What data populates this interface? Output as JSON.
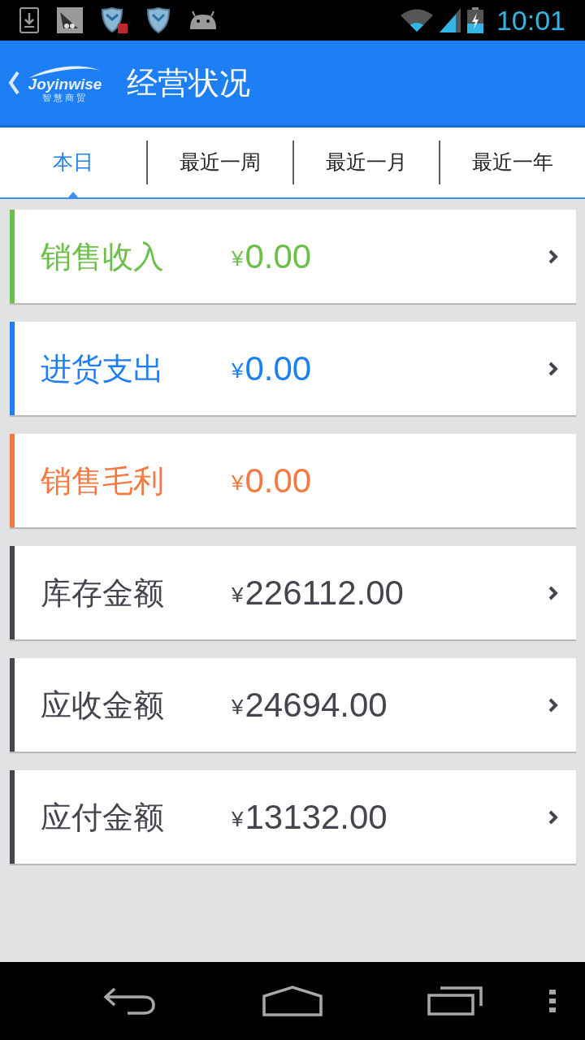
{
  "status_bar": {
    "time": "10:01"
  },
  "app_bar": {
    "logo": {
      "name": "Joyinwise",
      "subtitle": "智慧商贸"
    },
    "title": "经营状况"
  },
  "tabs": [
    {
      "label": "本日",
      "selected": true
    },
    {
      "label": "最近一周",
      "selected": false
    },
    {
      "label": "最近一月",
      "selected": false
    },
    {
      "label": "最近一年",
      "selected": false
    }
  ],
  "cards": [
    {
      "label": "销售收入",
      "currency": "¥",
      "amount": "0.00",
      "color": "#6cc04a",
      "has_arrow": true
    },
    {
      "label": "进货支出",
      "currency": "¥",
      "amount": "0.00",
      "color": "#1e7ff5",
      "has_arrow": true
    },
    {
      "label": "销售毛利",
      "currency": "¥",
      "amount": "0.00",
      "color": "#f47a42",
      "has_arrow": false
    },
    {
      "label": "库存金额",
      "currency": "¥",
      "amount": "226112.00",
      "color": "#45444f",
      "has_arrow": true
    },
    {
      "label": "应收金额",
      "currency": "¥",
      "amount": "24694.00",
      "color": "#45444f",
      "has_arrow": true
    },
    {
      "label": "应付金额",
      "currency": "¥",
      "amount": "13132.00",
      "color": "#45444f",
      "has_arrow": true
    }
  ]
}
